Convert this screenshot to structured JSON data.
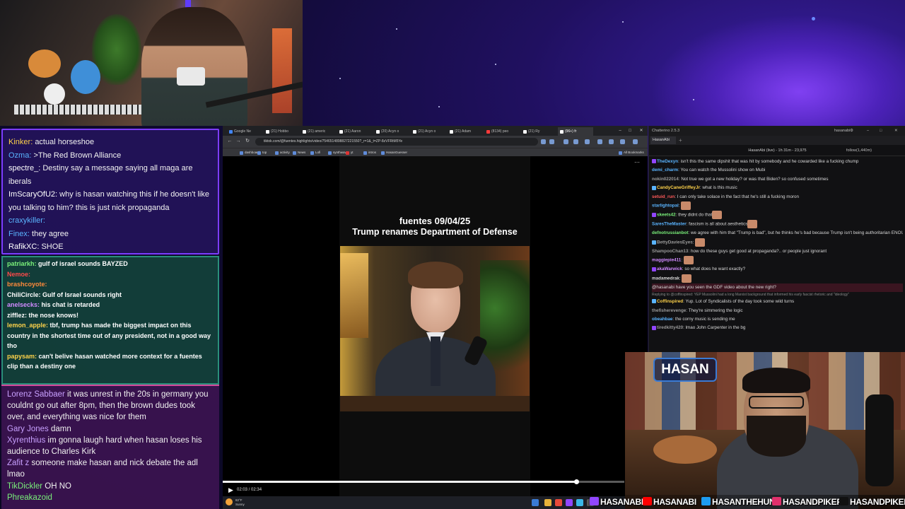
{
  "left_chat_top": [
    {
      "user": "Kinker",
      "text": "actual horseshoe",
      "color": "#ffd34a"
    },
    {
      "user": "Ozma",
      "text": ">The Red Brown Alliance",
      "color": "#5ab4ff"
    },
    {
      "user": "spectre_",
      "text": "Destiny say a message saying all maga are iberals",
      "color": "#ffffff"
    },
    {
      "user": "ImScaryOfU2",
      "text": "why is hasan watching this if he doesn't like you talking to him? this is just nick propaganda",
      "color": "#ffffff"
    },
    {
      "user": "craxykiller",
      "text": "",
      "color": "#5ab4ff"
    },
    {
      "user": "Finex",
      "text": "they agree",
      "color": "#5ab4ff"
    },
    {
      "user": "RafikXC",
      "text": "SHOE",
      "color": "#ffffff"
    }
  ],
  "left_chat_mid": [
    {
      "user": "patriarkh",
      "text": "gulf of israel sounds BAYZED",
      "color": "#7af07a"
    },
    {
      "user": "Nemoe",
      "text": "",
      "color": "#ff4a4a"
    },
    {
      "user": "brashcoyote",
      "text": "",
      "color": "#ff8a3a"
    },
    {
      "user": "ChiliCircle",
      "text": "Gulf of Israel sounds right",
      "color": "#ffffff"
    },
    {
      "user": "anelsecks",
      "text": "his chat is retarded",
      "color": "#d08aff"
    },
    {
      "user": "zifflez",
      "text": "the nose knows!",
      "color": "#ffffff"
    },
    {
      "user": "lemon_apple",
      "text": "tbf, trump has made the biggest impact on this country in the shortest time out of any president, not in a good way tho",
      "color": "#ffd34a"
    },
    {
      "user": "papysam",
      "text": "can't belive hasan watched more context for a fuentes clip than a destiny one",
      "color": "#ffd34a"
    }
  ],
  "left_chat_bottom": [
    {
      "user": "Lorenz Sabbaer",
      "text": "it was unrest in the 20s in germany you couldnt go out after 8pm, then the brown dudes took over, and everything was nice for them",
      "color": "#c8a0ff"
    },
    {
      "user": "Gary Jones",
      "text": "damn",
      "color": "#c8a0ff"
    },
    {
      "user": "Xyrenthius",
      "text": "im gonna laugh hard when hasan loses his audience to Charles Kirk",
      "color": "#c8a0ff"
    },
    {
      "user": "Zafit z",
      "text": "someone make hasan and nick debate the adl lmao",
      "color": "#c8a0ff"
    },
    {
      "user": "TikDickler",
      "text": "OH NO",
      "color": "#7af07a"
    },
    {
      "user": "Phreakazoid",
      "text": "",
      "color": "#7af07a"
    }
  ],
  "browser": {
    "tabs": [
      {
        "label": "Google Ne",
        "color": "#4285f4"
      },
      {
        "label": "(21) Hobbo",
        "color": "#ffffff"
      },
      {
        "label": "(21) americ",
        "color": "#ffffff"
      },
      {
        "label": "(21) Aaron",
        "color": "#ffffff"
      },
      {
        "label": "(20) Acyn o",
        "color": "#ffffff"
      },
      {
        "label": "(21) Acyn o",
        "color": "#ffffff"
      },
      {
        "label": "(21) Adam",
        "color": "#ffffff"
      },
      {
        "label": "(8134) peo",
        "color": "#ff3a3a"
      },
      {
        "label": "(21) Ry",
        "color": "#ffffff"
      },
      {
        "label": "(96+) fr",
        "color": "#ffffff"
      }
    ],
    "url": "tiktok.com/@fuentes.highlights/video/7546514898827221550?_r=1&_t=ZP-8zVFRtM5Ye",
    "bookmarks": [
      "dashboard",
      "top",
      "activity",
      "News",
      "Lofi",
      "synthwave",
      "yt",
      "intros",
      "HasanGuesser"
    ],
    "all_bookmarks": "All Bookmarks",
    "video_caption_line1": "fuentes 09/04/25",
    "video_caption_line2": "Trump renames Department of Defense",
    "time": "02:03 / 02:34",
    "progress": 0.88,
    "weather_temp": "82°F",
    "weather_desc": "Sunny"
  },
  "chatterino": {
    "title": "Chatterino 2.5.3",
    "account": "hasanabi",
    "tab": "HasanAbi",
    "header": "HasanAbi (live) - 1h 31m - 23,975",
    "follow": "follow(1,440m)",
    "messages": [
      {
        "user": "TheDexyn",
        "text": "isn't this the same dipshit that was hit by somebody and he cowarded like a fucking chump",
        "color": "#5ab4ff"
      },
      {
        "user": "demi_charm",
        "text": "You can watch the Mussolini show on Mubi",
        "color": "#5ab4ff"
      },
      {
        "user": "nokin022014",
        "text": "Not true we got a new holiday? or was that Biden? so confused sometimes",
        "color": "#9a9a9a"
      },
      {
        "user": "CandyCaneGriffeyJr",
        "text": "what is this music",
        "color": "#ffd34a"
      },
      {
        "user": "setuid_run",
        "text": "I can only take solace in the fact that he's still a fucking moron",
        "color": "#ff5a5a"
      },
      {
        "user": "starlightopal",
        "text": "",
        "color": "#5ab4ff"
      },
      {
        "user": "skeets42",
        "text": "they didnt do that",
        "color": "#7af07a"
      },
      {
        "user": "SaresTheMaster",
        "text": "fascism is all about aesthetics",
        "color": "#5ab4ff"
      },
      {
        "user": "defnotrussianbot",
        "text": "we agree with him that \"Trump is bad\", but he thinks he's bad because Trump isn't being authoritarian ENOUGH",
        "color": "#7af07a"
      },
      {
        "user": "BettyDaviesEyes",
        "text": "",
        "color": "#9a9a9a"
      },
      {
        "user": "ShampooChan13",
        "text": "how do these guys get good at propaganda?.. or people just ignorant",
        "color": "#9a9a9a"
      },
      {
        "user": "maggiepie411",
        "text": "",
        "color": "#d08aff"
      },
      {
        "user": "akaWarwick",
        "text": "so what does he want exactly?",
        "color": "#d08aff"
      },
      {
        "user": "madamedrak",
        "text": "",
        "color": "#d8d8d8"
      },
      {
        "user": "",
        "text": "@hasanabi have you seen the GDF video about the new right?",
        "color": "#ff5a5a"
      },
      {
        "user": "Coffinspired",
        "text": "Yup. Lot of Syndicalists of the day took some wild turns",
        "color": "#ffd34a"
      },
      {
        "user": "thefisherevenge",
        "text": "They're simmering the logic",
        "color": "#9a9a9a"
      },
      {
        "user": "obeahbae",
        "text": "the corny music is sending me",
        "color": "#5ab4ff"
      },
      {
        "user": "tiredkitty420",
        "text": "lmao John Carpenter in the bg",
        "color": "#9a9a9a"
      }
    ],
    "reply_note": "Replying to @coffinspired: YEP Mussolini had a long Marxist background that informed his early fascist rhetoric and \"ideology\""
  },
  "cam": {
    "logo": "HASAN"
  },
  "social": {
    "twitch": "HASANABI",
    "youtube": "HASANABI",
    "twitter": "HASANTHEHUN",
    "instagram": "HASANDPIKER",
    "tiktok": "HASANDPIKER",
    "colors": {
      "twitch": "#9146ff",
      "youtube": "#ff0000",
      "twitter": "#1d9bf0",
      "instagram": "#e1306c",
      "tiktok": "#111111"
    }
  }
}
